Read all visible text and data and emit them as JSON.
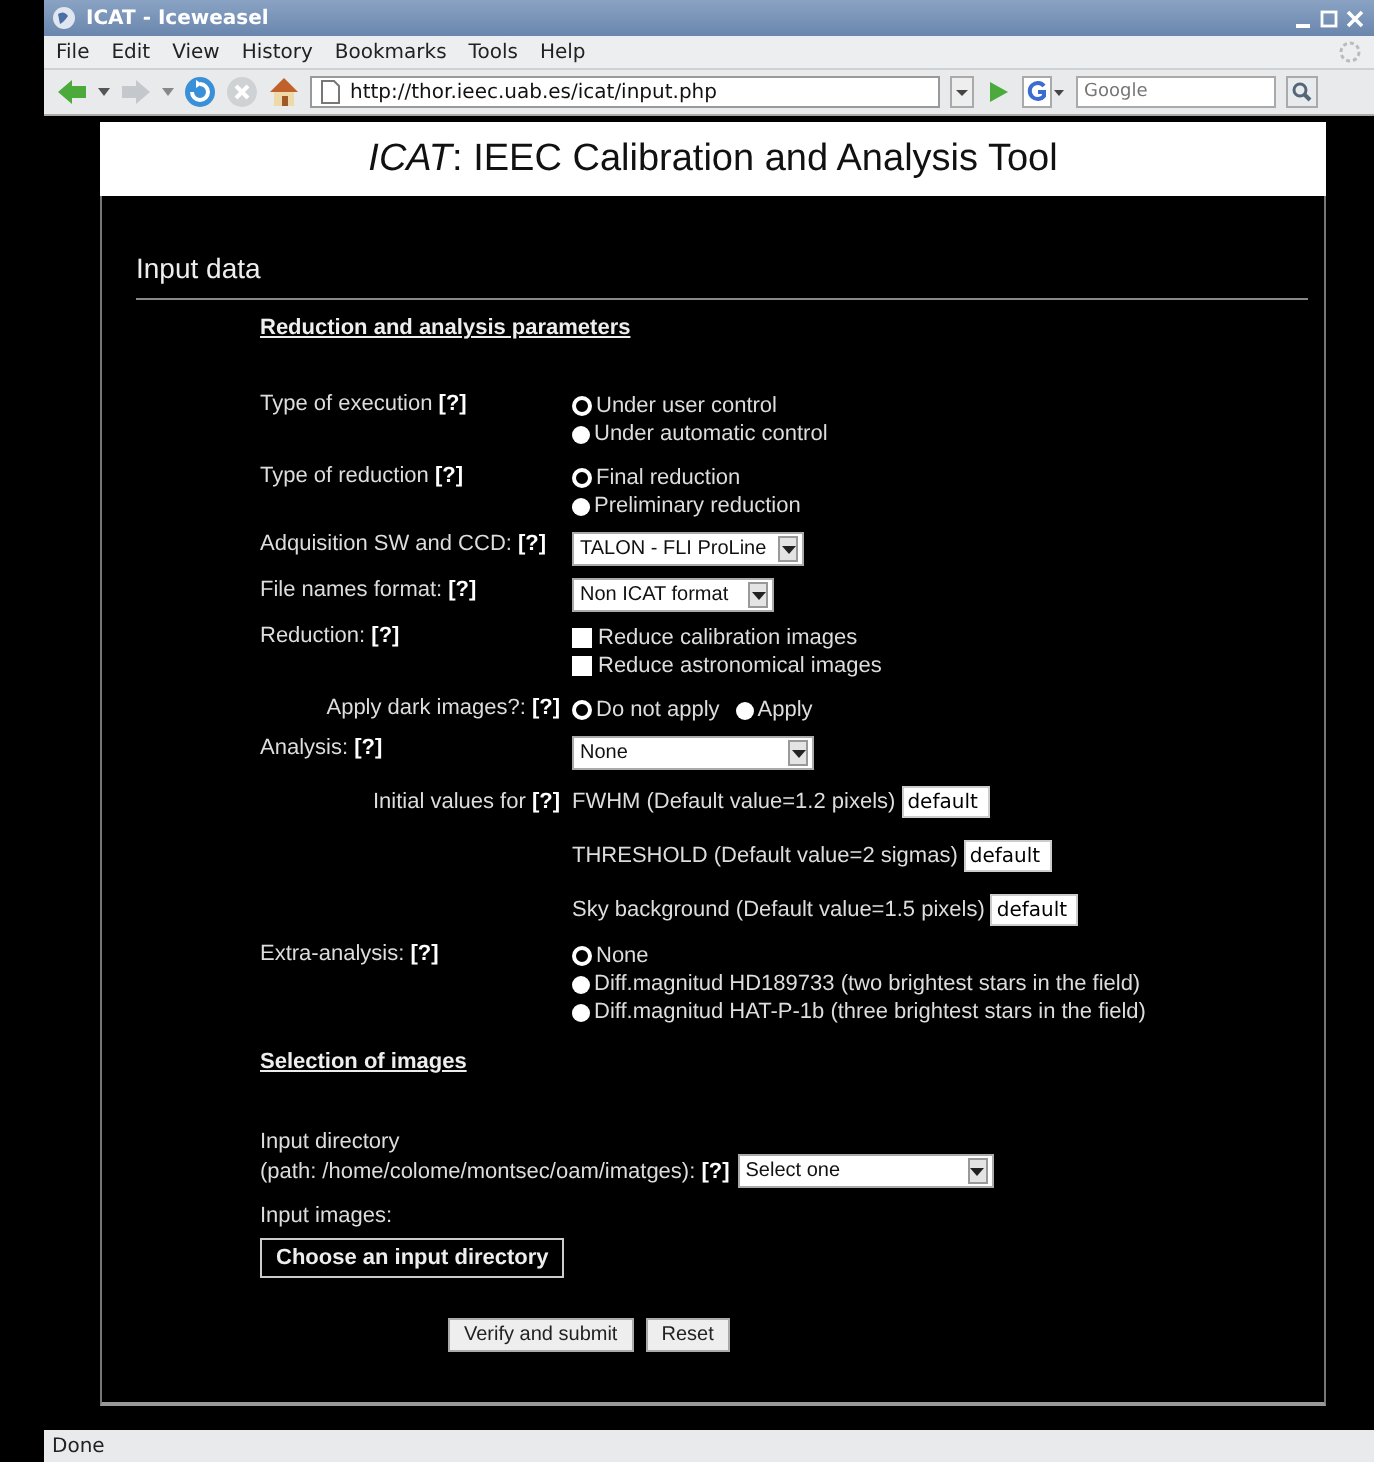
{
  "window": {
    "title": "ICAT - Iceweasel"
  },
  "menu": [
    "File",
    "Edit",
    "View",
    "History",
    "Bookmarks",
    "Tools",
    "Help"
  ],
  "toolbar": {
    "url": "http://thor.ieec.uab.es/icat/input.php",
    "search_placeholder": "Google"
  },
  "page": {
    "title": "*ICAT*: IEEC Calibration and Analysis Tool",
    "heading": "Input data",
    "section_1": "Reduction and analysis parameters",
    "rows": [
      {
        "kind": "radio",
        "label": "Type of execution **[?]**",
        "options": [
          {
            "label": "Under user control",
            "selected": true
          },
          {
            "label": "Under automatic control",
            "selected": false
          }
        ]
      },
      {
        "kind": "radio",
        "label": "Type of reduction **[?]**",
        "options": [
          {
            "label": "Final reduction",
            "selected": true
          },
          {
            "label": "Preliminary reduction",
            "selected": false
          }
        ]
      },
      {
        "kind": "select",
        "label": "Adquisition SW and CCD: **[?]**",
        "value": "TALON - FLI ProLine"
      },
      {
        "kind": "select",
        "label": "File names format: **[?]**",
        "value": "Non ICAT format"
      },
      {
        "kind": "checkbox",
        "label": "Reduction: **[?]**",
        "options": [
          {
            "label": "Reduce calibration images",
            "checked": false
          },
          {
            "label": "Reduce astronomical images",
            "checked": false
          }
        ]
      },
      {
        "kind": "inline-radio",
        "label": "Apply dark images?: **[?]**",
        "options": [
          {
            "label": "Do not apply",
            "selected": true
          },
          {
            "label": "Apply",
            "selected": false
          }
        ]
      },
      {
        "kind": "select",
        "label": "Analysis: **[?]**",
        "value": "None"
      },
      {
        "kind": "values",
        "label": "Initial values for **[?]**",
        "fields": [
          {
            "label": "FWHM (Default value=1.2 pixels)",
            "value": "default"
          },
          {
            "label": "THRESHOLD (Default value=2 sigmas)",
            "value": "default"
          },
          {
            "label": "Sky background (Default value=1.5 pixels)",
            "value": "default"
          }
        ]
      },
      {
        "kind": "radio",
        "label": "Extra-analysis: **[?]**",
        "options": [
          {
            "label": "None",
            "selected": true
          },
          {
            "label": "Diff.magnitud HD189733 (two brightest stars in the field)",
            "selected": false
          },
          {
            "label": "Diff.magnitud HAT-P-1b (three brightest stars in the field)",
            "selected": false
          }
        ]
      }
    ],
    "section_2": "Selection of images",
    "directory_label": "Input directory",
    "directory_path": "(path: /home/colome/montsec/oam/imatges): **[?]**",
    "directory_value": "Select one",
    "images_label": "Input images:",
    "choose_button": "Choose an input directory",
    "buttons": [
      "Verify and submit",
      "Reset"
    ]
  },
  "status_bar": "Done"
}
